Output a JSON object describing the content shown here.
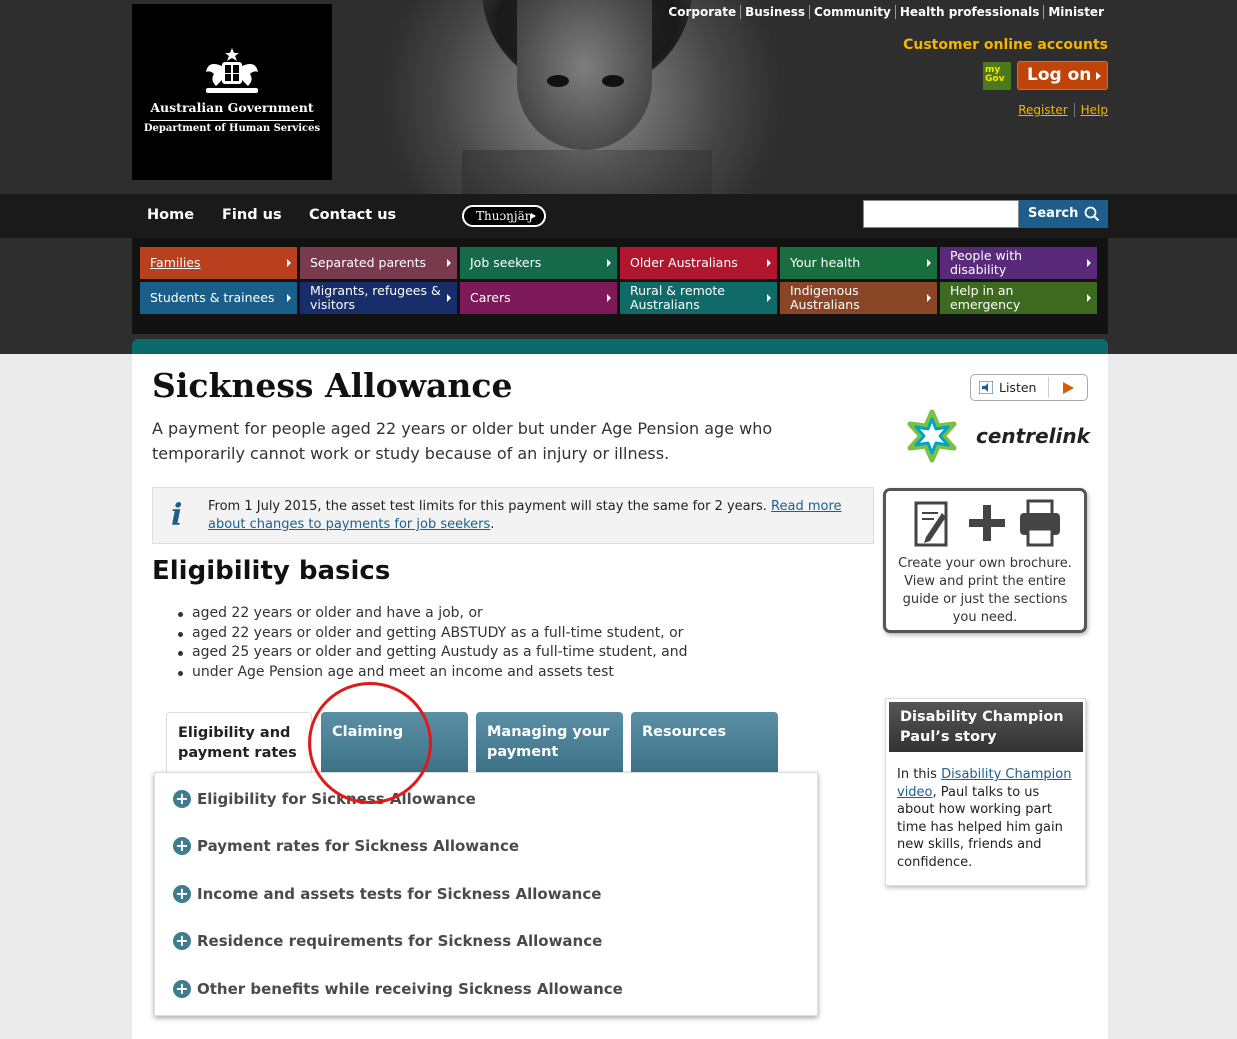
{
  "header": {
    "logo": {
      "line1": "Australian Government",
      "line2": "Department of Human Services"
    },
    "utility_nav": [
      "Corporate",
      "Business",
      "Community",
      "Health professionals",
      "Minister"
    ],
    "customer_accounts": {
      "title": "Customer online accounts",
      "mygov_badge": "my Gov",
      "logon_label": "Log on",
      "register": "Register",
      "help": "Help"
    },
    "main_nav": [
      "Home",
      "Find us",
      "Contact us"
    ],
    "language_button": "Thuɔŋjäŋ",
    "search": {
      "placeholder": "",
      "button": "Search"
    },
    "categories": [
      {
        "label": "Families",
        "color": "#b8401e"
      },
      {
        "label": "Separated parents",
        "color": "#7a3a4e"
      },
      {
        "label": "Job seekers",
        "color": "#146a4a"
      },
      {
        "label": "Older Australians",
        "color": "#b0162e"
      },
      {
        "label": "Your health",
        "color": "#186e3c"
      },
      {
        "label": "People with disability",
        "color": "#5a2a7a"
      },
      {
        "label": "Students & trainees",
        "color": "#1a5f8a"
      },
      {
        "label": "Migrants, refugees & visitors",
        "color": "#182e6a"
      },
      {
        "label": "Carers",
        "color": "#7e1a5a"
      },
      {
        "label": "Rural & remote Australians",
        "color": "#106a68"
      },
      {
        "label": "Indigenous Australians",
        "color": "#8a4526"
      },
      {
        "label": "Help in an emergency",
        "color": "#3e6a20"
      }
    ]
  },
  "page": {
    "title": "Sickness Allowance",
    "intro": "A payment for people aged 22 years or older but under Age Pension age who temporarily cannot work or study because of an injury or illness.",
    "listen": "Listen",
    "brand": "centrelink",
    "notice": {
      "text": "From 1 July 2015, the asset test limits for this payment will stay the same for 2 years. ",
      "link": "Read more about changes to payments for job seekers",
      "end": "."
    },
    "eligibility": {
      "heading": "Eligibility basics",
      "items": [
        "aged 22 years or older and have a job, or",
        "aged 22 years or older and getting ABSTUDY as a full-time student, or",
        "aged 25 years or older and getting Austudy as a full-time student, and",
        "under Age Pension age and meet an income and assets test"
      ]
    },
    "tabs": [
      "Eligibility and payment rates",
      "Claiming",
      "Managing your payment",
      "Resources"
    ],
    "accordion": [
      "Eligibility for Sickness Allowance",
      "Payment rates for Sickness Allowance",
      "Income and assets tests for Sickness Allowance",
      "Residence requirements for Sickness Allowance",
      "Other benefits while receiving Sickness Allowance"
    ]
  },
  "sidebar": {
    "brochure": "Create your own brochure. View and print the entire guide or just the sections you need.",
    "champion": {
      "heading": "Disability Champion Paul’s story",
      "text_before": "In this ",
      "link": "Disability Champion video",
      "text_after": ", Paul talks to us about how working part time has helped him gain new skills, friends and confidence."
    }
  }
}
